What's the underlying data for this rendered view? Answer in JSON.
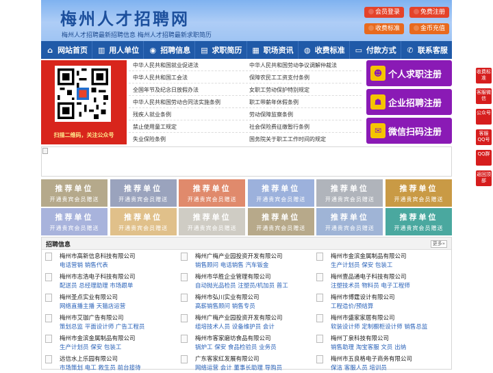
{
  "header": {
    "logo": "梅州人才招聘网",
    "slogan": "梅州人才招聘最新招聘信息   梅州人才招聘最新求职简历",
    "buttons": {
      "login": "会员登录",
      "register": "免费注册",
      "fee": "收费标准",
      "coin": "金币充值"
    }
  },
  "nav": [
    "网站首页",
    "用人单位",
    "招聘信息",
    "求职简历",
    "职场资讯",
    "收费标准",
    "付款方式",
    "联系客服"
  ],
  "qr": {
    "caption": "扫描二维码，关注公众号"
  },
  "links": [
    [
      "中华人民共和国就业促进法",
      "中华人民共和国劳动争议调解仲裁法"
    ],
    [
      "中华人民共和国工会法",
      "保障农民工工资支付条例"
    ],
    [
      "全国年节及纪念日放假办法",
      "女职工劳动保护特别规定"
    ],
    [
      "中华人民共和国劳动合同法实施条例",
      "职工带薪年休假条例"
    ],
    [
      "残疾人就业条例",
      "劳动保障监察条例"
    ],
    [
      "禁止使用童工规定",
      "社会保险费征缴暂行条例"
    ],
    [
      "失业保险条例",
      "国务院关于职工工作时间的规定"
    ]
  ],
  "register_buttons": [
    "个人求职注册",
    "企业招聘注册",
    "微信扫码注册"
  ],
  "recommend": {
    "title": "推荐单位",
    "sub": "开通贵宾会员赠送",
    "colors": [
      "#b5a98b",
      "#9aa3bd",
      "#e08a6c",
      "#9cb1dc",
      "#b0b4bb",
      "#c99a45",
      "#a8b3dc",
      "#e0c08a",
      "#cfccc4",
      "#b7a98a",
      "#9fb4d6",
      "#4aa89f"
    ]
  },
  "jobs": {
    "title": "招聘信息",
    "more": "更多»",
    "items": [
      {
        "company": "梅州市高新信息科技有限公司",
        "positions": "电话营销 销售代表"
      },
      {
        "company": "梅州广梅产业园投资开发有限公司",
        "positions": "销售顾问 电话销售 汽车钣金"
      },
      {
        "company": "梅州市金滨金属制品有限公司",
        "positions": "生产计划员 保安 包装工"
      },
      {
        "company": "梅州市志浩电子科技有限公司",
        "positions": "配送员 总经理助理 市场跟单"
      },
      {
        "company": "梅州市华胜企业管理有限公司",
        "positions": "自动抛光品检员 注塑员/机加员 普工"
      },
      {
        "company": "梅州壹品通电子科技有限公司",
        "positions": "注塑技术员 物料员 电子工程师"
      },
      {
        "company": "梅州圣点实业有限公司",
        "positions": "网络直播主播 天猫店运营"
      },
      {
        "company": "梅州市弘川实业有限公司",
        "positions": "高薪销售顾问 销售专员"
      },
      {
        "company": "梅州市博霆设计有限公司",
        "positions": "工程造价/预结算"
      },
      {
        "company": "梅州市艾珈广告有限公司",
        "positions": "策划总监 平面设计师 广告工程员"
      },
      {
        "company": "梅州广梅产业园投资开发有限公司",
        "positions": "组培技术人员 设备维护员 会计"
      },
      {
        "company": "梅州市盛家家居有限公司",
        "positions": "软装设计师 定制橱柜设计师 销售总监"
      },
      {
        "company": "梅州市金滨金属制品有限公司",
        "positions": "生产计划员 保安 包装工"
      },
      {
        "company": "梅州市客家磨坊食品有限公司",
        "positions": "锅炉工 保安 食品检验员 业务员"
      },
      {
        "company": "梅州丁泉科技有限公司",
        "positions": "销售助理 淘宝客服 文员 出纳"
      },
      {
        "company": "远信水上乐园有限公司",
        "positions": "市场策划 电工 救生员 前台接待"
      },
      {
        "company": "广东客家红发展有限公司",
        "positions": "网络运营 会计 董事长助理 导购员"
      },
      {
        "company": "梅州市五良格电子商务有限公司",
        "positions": "保洁 客服人员 培训员"
      }
    ]
  },
  "side_float": [
    "收费标准",
    "客服微信",
    "公众号",
    "客服QQ号",
    "QQ群",
    "返回顶部"
  ]
}
